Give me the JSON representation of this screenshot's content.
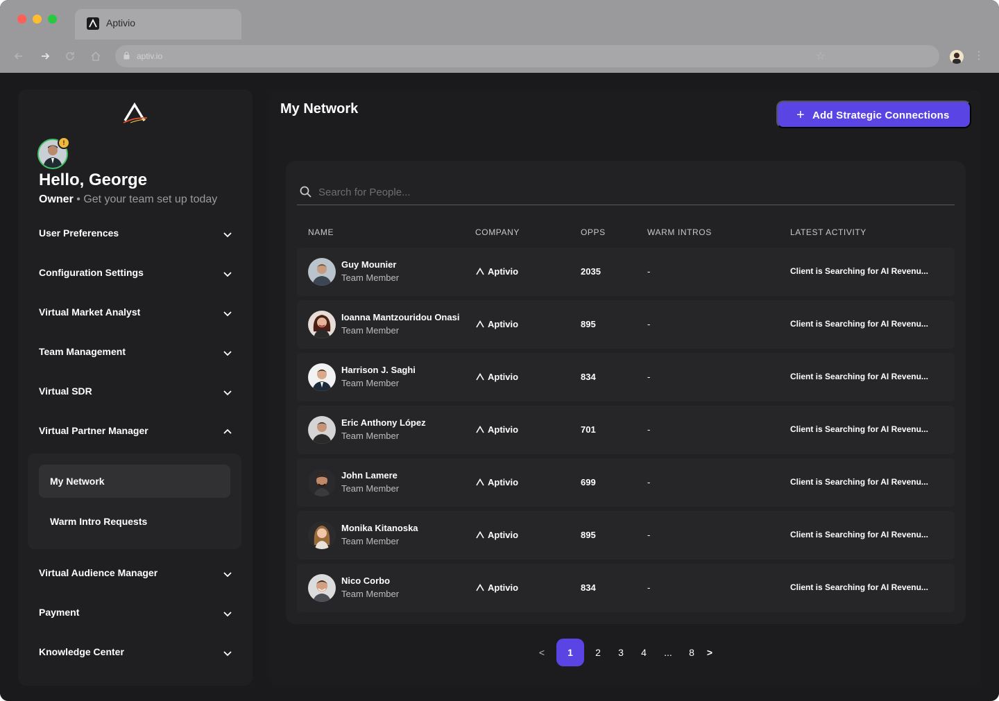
{
  "browser": {
    "tab_title": "Aptivio",
    "url": "aptiv.io"
  },
  "sidebar": {
    "greeting": "Hello, George",
    "role": "Owner",
    "role_separator": "•",
    "tagline": "Get your team set up today",
    "menu": [
      {
        "label": "User Preferences",
        "expanded": false
      },
      {
        "label": "Configuration Settings",
        "expanded": false
      },
      {
        "label": "Virtual Market Analyst",
        "expanded": false
      },
      {
        "label": "Team Management",
        "expanded": false
      },
      {
        "label": "Virtual SDR",
        "expanded": false
      },
      {
        "label": "Virtual Partner Manager",
        "expanded": true
      },
      {
        "label": "Virtual Audience Manager",
        "expanded": false
      },
      {
        "label": "Payment",
        "expanded": false
      },
      {
        "label": "Knowledge Center",
        "expanded": false
      }
    ],
    "submenu": [
      {
        "label": "My Network",
        "active": true
      },
      {
        "label": "Warm Intro Requests",
        "active": false
      }
    ]
  },
  "main": {
    "title": "My Network",
    "add_button": "Add Strategic Connections",
    "search_placeholder": "Search for People...",
    "columns": [
      "NAME",
      "COMPANY",
      "OPPS",
      "WARM INTROS",
      "LATEST ACTIVITY"
    ],
    "rows": [
      {
        "name": "Guy Mounier",
        "role": "Team Member",
        "company": "Aptivio",
        "opps": "2035",
        "warm": "-",
        "activity": "Client is Searching for AI Revenu..."
      },
      {
        "name": "Ioanna Mantzouridou Onasi",
        "role": "Team Member",
        "company": "Aptivio",
        "opps": "895",
        "warm": "-",
        "activity": "Client is Searching for AI Revenu..."
      },
      {
        "name": "Harrison J. Saghi",
        "role": "Team Member",
        "company": "Aptivio",
        "opps": "834",
        "warm": "-",
        "activity": "Client is Searching for AI Revenu..."
      },
      {
        "name": "Eric Anthony López",
        "role": "Team Member",
        "company": "Aptivio",
        "opps": "701",
        "warm": "-",
        "activity": "Client is Searching for AI Revenu..."
      },
      {
        "name": "John Lamere",
        "role": "Team Member",
        "company": "Aptivio",
        "opps": "699",
        "warm": "-",
        "activity": "Client is Searching for AI Revenu..."
      },
      {
        "name": "Monika Kitanoska",
        "role": "Team Member",
        "company": "Aptivio",
        "opps": "895",
        "warm": "-",
        "activity": "Client is Searching for AI Revenu..."
      },
      {
        "name": "Nico Corbo",
        "role": "Team Member",
        "company": "Aptivio",
        "opps": "834",
        "warm": "-",
        "activity": "Client is Searching for AI Revenu..."
      }
    ],
    "pagination": {
      "prev": "<",
      "pages": [
        "1",
        "2",
        "3",
        "4",
        "...",
        "8"
      ],
      "current": "1",
      "next": ">"
    }
  },
  "colors": {
    "accent": "#5b44e4",
    "status_online": "#3fbf62",
    "warning": "#f1b73b"
  },
  "icons": [
    "aptivio-logo-icon",
    "chevron-down-icon",
    "chevron-up-icon",
    "search-icon",
    "plus-icon",
    "warning-icon",
    "lock-icon",
    "star-icon",
    "kebab-icon",
    "back-icon",
    "forward-icon",
    "reload-icon",
    "home-icon"
  ]
}
